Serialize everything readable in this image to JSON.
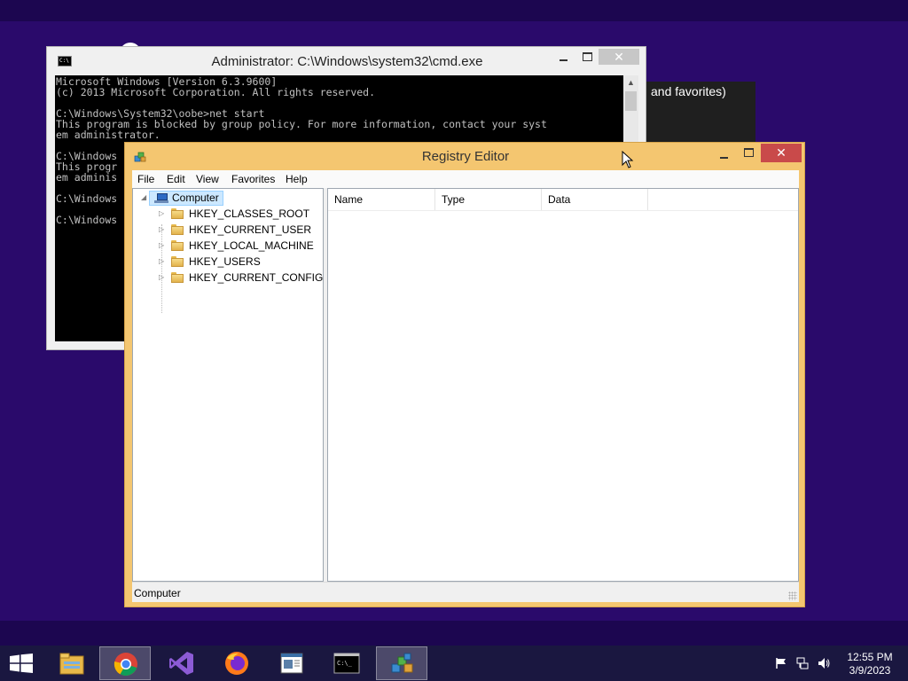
{
  "background_window": {
    "text": "and favorites)"
  },
  "cmd": {
    "title": "Administrator: C:\\Windows\\system32\\cmd.exe",
    "close_label": "✕",
    "console_lines": [
      "Microsoft Windows [Version 6.3.9600]",
      "(c) 2013 Microsoft Corporation. All rights reserved.",
      "",
      "C:\\Windows\\System32\\oobe>net start",
      "This program is blocked by group policy. For more information, contact your syst",
      "em administrator.",
      "",
      "C:\\Windows",
      "This progr",
      "em adminis",
      "",
      "C:\\Windows",
      "",
      "C:\\Windows"
    ]
  },
  "registry": {
    "title": "Registry Editor",
    "close_label": "✕",
    "menu": [
      "File",
      "Edit",
      "View",
      "Favorites",
      "Help"
    ],
    "tree": {
      "root": "Computer",
      "children": [
        "HKEY_CLASSES_ROOT",
        "HKEY_CURRENT_USER",
        "HKEY_LOCAL_MACHINE",
        "HKEY_USERS",
        "HKEY_CURRENT_CONFIG"
      ]
    },
    "columns": [
      "Name",
      "Type",
      "Data"
    ],
    "status": "Computer"
  },
  "taskbar": {
    "apps": [
      "file-explorer",
      "chrome",
      "visual-studio",
      "firefox",
      "notepad-app",
      "command-prompt",
      "registry-editor"
    ],
    "active_app": "registry-editor",
    "clock_time": "12:55 PM",
    "clock_date": "3/9/2023"
  }
}
